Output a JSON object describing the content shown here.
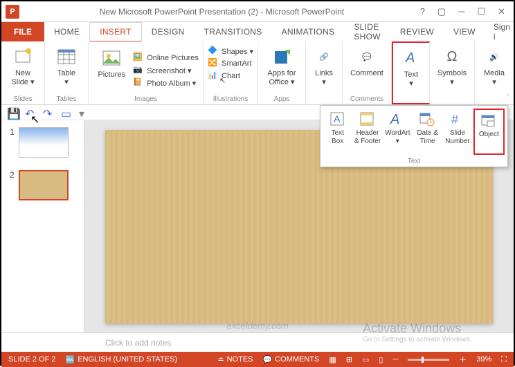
{
  "title": "New Microsoft PowerPoint Presentation (2) - Microsoft PowerPoint",
  "tabs": {
    "file": "FILE",
    "home": "HOME",
    "insert": "INSERT",
    "design": "DESIGN",
    "transitions": "TRANSITIONS",
    "animations": "ANIMATIONS",
    "slideshow": "SLIDE SHOW",
    "review": "REVIEW",
    "view": "VIEW",
    "signin": "Sign i"
  },
  "ribbon": {
    "slides": {
      "new": "New\nSlide ▾",
      "label": "Slides"
    },
    "tables": {
      "btn": "Table\n▾",
      "label": "Tables"
    },
    "images": {
      "pictures": "Pictures",
      "online": "Online Pictures",
      "screenshot": "Screenshot ▾",
      "album": "Photo Album ▾",
      "label": "Images"
    },
    "illus": {
      "shapes": "Shapes ▾",
      "smartart": "SmartArt",
      "chart": "Chart",
      "label": "Illustrations"
    },
    "apps": {
      "btn": "Apps for\nOffice ▾",
      "label": "Apps"
    },
    "links": {
      "btn": "Links\n▾"
    },
    "comments": {
      "btn": "Comment",
      "label": "Comments"
    },
    "text": {
      "btn": "Text\n▾"
    },
    "symbols": {
      "btn": "Symbols\n▾"
    },
    "media": {
      "btn": "Media\n▾"
    }
  },
  "dropdown": {
    "textbox": "Text\nBox",
    "header": "Header\n& Footer",
    "wordart": "WordArt\n▾",
    "datetime": "Date &\nTime",
    "slidenum": "Slide\nNumber",
    "object": "Object",
    "label": "Text"
  },
  "thumbs": {
    "n1": "1",
    "n2": "2"
  },
  "notes": "Click to add notes",
  "status": {
    "slide": "SLIDE 2 OF 2",
    "lang": "ENGLISH (UNITED STATES)",
    "notes": "NOTES",
    "comments": "COMMENTS",
    "zoom": "39%"
  },
  "wm": {
    "t": "Activate Windows",
    "s": "Go to Settings to activate Windows."
  },
  "wmsite": "exceldemy.com"
}
